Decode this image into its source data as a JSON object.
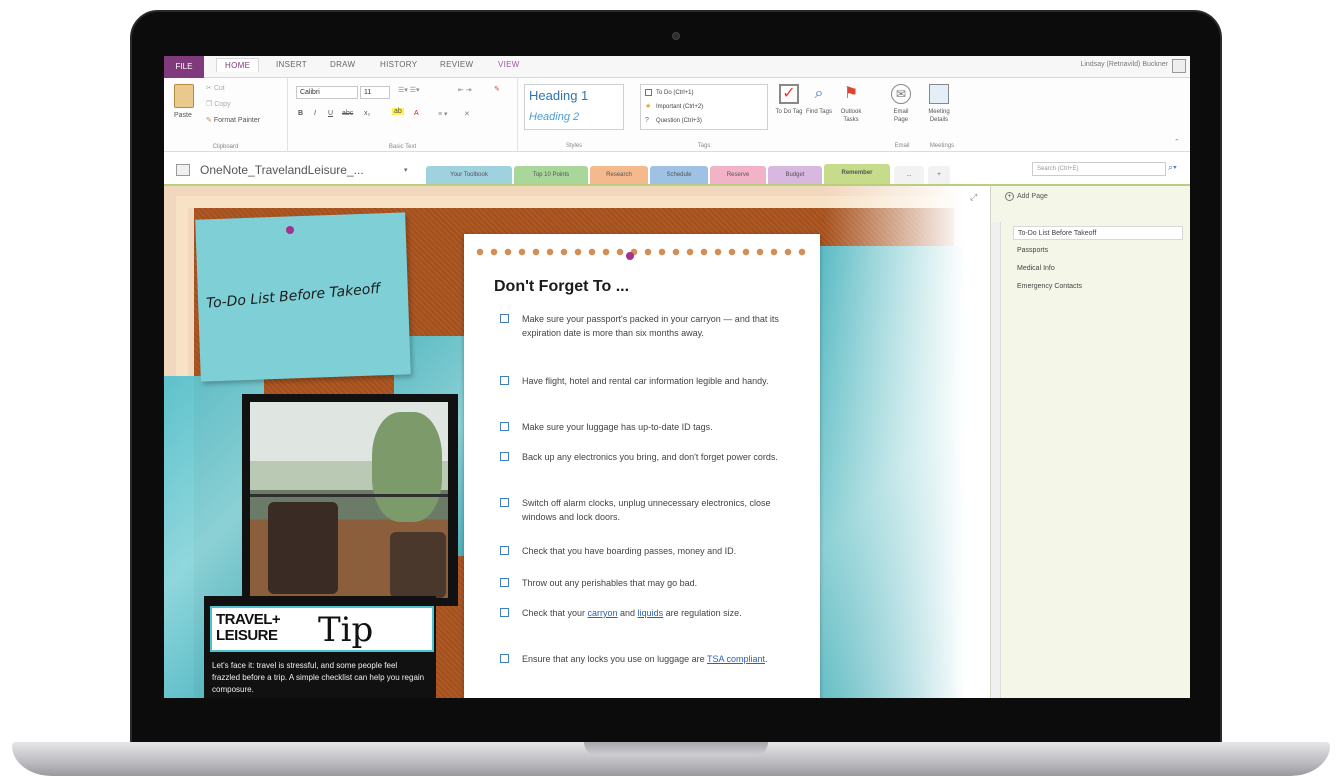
{
  "ribbon_tabs": {
    "file": "FILE",
    "home": "HOME",
    "insert": "INSERT",
    "draw": "DRAW",
    "history": "HISTORY",
    "review": "REVIEW",
    "view": "VIEW"
  },
  "user": {
    "name": "Lindsay (Retnavild) Buckner"
  },
  "clipboard": {
    "paste": "Paste",
    "cut": "Cut",
    "copy": "Copy",
    "format_painter": "Format Painter",
    "group": "Clipboard"
  },
  "basic_text": {
    "font": "Calibri",
    "size": "11",
    "group": "Basic Text",
    "buttons": [
      "B",
      "I",
      "U",
      "abc",
      "x₂",
      "A"
    ]
  },
  "styles": {
    "heading1": "Heading 1",
    "heading2": "Heading 2",
    "group": "Styles"
  },
  "tags": {
    "todo": "To Do (Ctrl+1)",
    "important": "Important (Ctrl+2)",
    "question": "Question (Ctrl+3)",
    "group": "Tags"
  },
  "big_buttons": {
    "todo_tag": "To Do Tag",
    "find_tags": "Find Tags",
    "outlook_tasks": "Outlook Tasks",
    "email_page": "Email Page",
    "meeting_details": "Meeting Details",
    "email_group": "Email",
    "meetings_group": "Meetings"
  },
  "notebook": {
    "name": "OneNote_TravelandLeisure_...",
    "sections": [
      {
        "label": "Your Toolbook",
        "color": "#9fd2de"
      },
      {
        "label": "Top 10 Points",
        "color": "#a9d69a"
      },
      {
        "label": "Research",
        "color": "#f4b98c"
      },
      {
        "label": "Schedule",
        "color": "#9fc1e4"
      },
      {
        "label": "Reserve",
        "color": "#f2b3c8"
      },
      {
        "label": "Budget",
        "color": "#d8b8e0"
      },
      {
        "label": "Remember",
        "color": "#c6dc8a"
      }
    ],
    "more": "...",
    "add": "+",
    "search_placeholder": "Search (Ctrl+E)"
  },
  "content": {
    "todo_note": "To-Do List Before Takeoff",
    "paper_title": "Don't Forget To ...",
    "items": [
      {
        "text": "Make sure your passport's packed in your carryon — and that its expiration date is more than six months away."
      },
      {
        "text": "Have flight, hotel and rental car information legible and handy."
      },
      {
        "text": "Make sure your luggage has up-to-date ID tags."
      },
      {
        "text": "Back up any electronics you bring, and don't forget power cords."
      },
      {
        "text": "Switch off alarm clocks, unplug unnecessary electronics, close windows and lock doors."
      },
      {
        "text": "Check that you have boarding passes, money and ID."
      },
      {
        "text": "Throw out any perishables that may go bad."
      },
      {
        "pre": "Check that your ",
        "link1": "carryon",
        "mid": " and ",
        "link2": "liquids",
        "post": " are regulation size."
      },
      {
        "pre": "Ensure that any locks you use on luggage are ",
        "link1": "TSA compliant",
        "post": "."
      }
    ],
    "tip_brand_line1": "TRAVEL+",
    "tip_brand_line2": "LEISURE",
    "tip_word": "Tip",
    "tip_body": "Let's face it: travel is stressful, and some people feel frazzled before a trip. A simple checklist can help you regain composure."
  },
  "pages_pane": {
    "add_page": "Add Page",
    "pages": [
      "To-Do List Before Takeoff",
      "Passports",
      "Medical Info",
      "Emergency Contacts"
    ],
    "active_index": 0
  },
  "colors": {
    "file_tab": "#80397b",
    "accent_link": "#2a62b8",
    "checkbox": "#3f7fc2",
    "section_bar": "#b9cf7c"
  }
}
